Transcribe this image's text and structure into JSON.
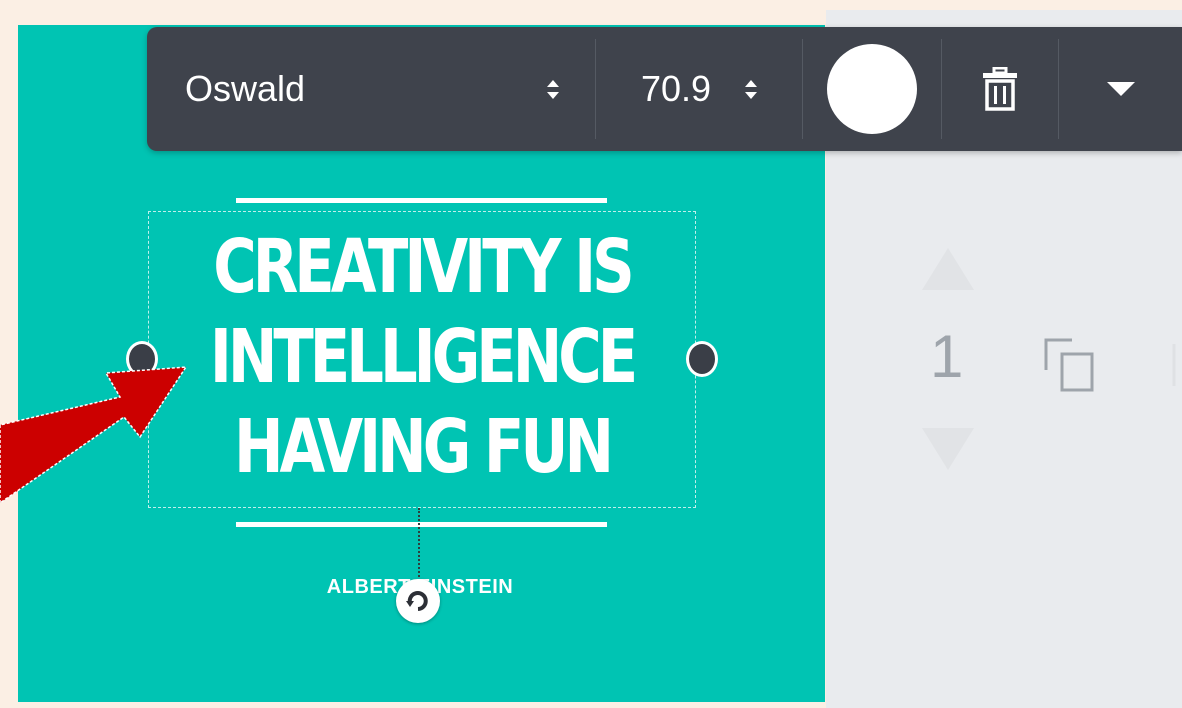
{
  "toolbar": {
    "font_family": "Oswald",
    "font_size": "70.9",
    "text_color": "#ffffff"
  },
  "canvas": {
    "background_color": "#00c4b3",
    "quote_lines": [
      "CREATIVITY IS",
      "INTELLIGENCE",
      "HAVING FUN"
    ],
    "author": "ALBERT EINSTEIN"
  },
  "page_controls": {
    "page_number": "1"
  },
  "icons": {
    "trash": "trash-icon",
    "dropdown": "chevron-down-icon",
    "rotate": "rotate-icon",
    "duplicate": "duplicate-page-icon",
    "move_up": "move-up-icon",
    "move_down": "move-down-icon",
    "annotation": "red-arrow-icon"
  },
  "colors": {
    "toolbar_bg": "#3f434c",
    "panel_bg": "#e9ebee",
    "arrow": "#cc0000"
  }
}
